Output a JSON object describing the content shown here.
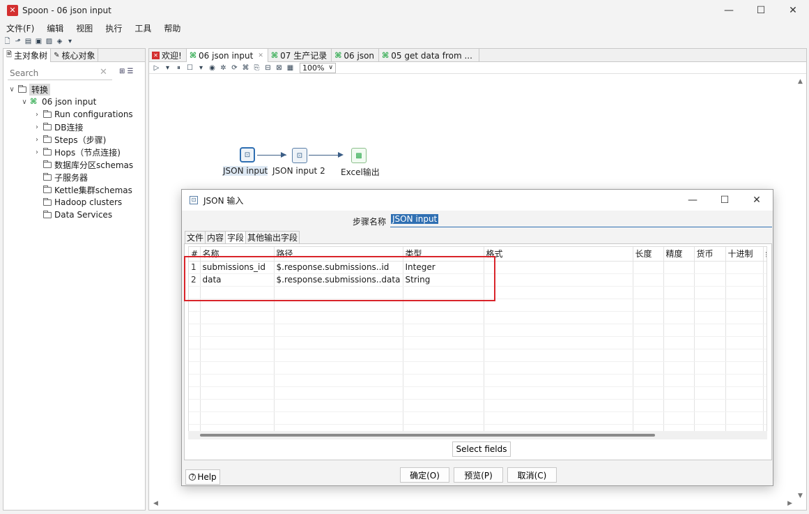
{
  "window": {
    "title": "Spoon - 06 json input",
    "minimize": "—",
    "maximize": "☐",
    "close": "✕"
  },
  "menu": [
    "文件(F)",
    "编辑",
    "视图",
    "执行",
    "工具",
    "帮助"
  ],
  "left_panel": {
    "tabs": [
      "主对象树",
      "核心对象"
    ],
    "search_placeholder": "Search",
    "tree": {
      "root": "转换",
      "transformation": "06 json input",
      "children": [
        "Run configurations",
        "DB连接",
        "Steps（步骤)",
        "Hops（节点连接)",
        "数据库分区schemas",
        "子服务器",
        "Kettle集群schemas",
        "Hadoop clusters",
        "Data Services"
      ]
    }
  },
  "editor": {
    "tabs": [
      "欢迎!",
      "06 json input",
      "07 生产记录",
      "06 json",
      "05 get data from ..."
    ],
    "zoom": "100%",
    "steps": [
      "JSON input",
      "JSON input 2",
      "Excel输出"
    ]
  },
  "dialog": {
    "title": "JSON 输入",
    "stepname_label": "步骤名称",
    "stepname_value": "JSON input",
    "tabs": [
      "文件",
      "内容",
      "字段",
      "其他输出字段"
    ],
    "columns": [
      "#",
      "名称",
      "路径",
      "类型",
      "格式",
      "长度",
      "精度",
      "货币",
      "十进制",
      "组"
    ],
    "rows": [
      {
        "num": "1",
        "name": "submissions_id",
        "path": "$.response.submissions..id",
        "type": "Integer"
      },
      {
        "num": "2",
        "name": "data",
        "path": "$.response.submissions..data",
        "type": "String"
      }
    ],
    "select_fields": "Select fields",
    "help": "Help",
    "ok": "确定(O)",
    "preview": "预览(P)",
    "cancel": "取消(C)"
  }
}
